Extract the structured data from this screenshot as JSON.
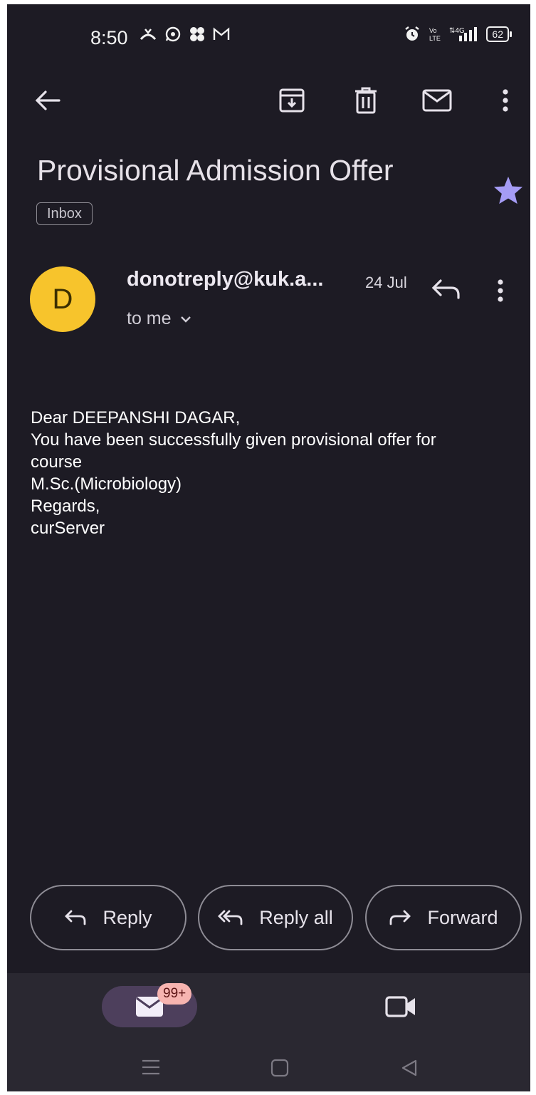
{
  "status_bar": {
    "time": "8:50",
    "left_icons": [
      "missed-call-icon",
      "whatsapp-icon",
      "pinwheel-app-icon",
      "gmail-icon"
    ],
    "right_icons": [
      "alarm-icon",
      "volte-icon",
      "4g-signal-icon"
    ],
    "battery": "62"
  },
  "toolbar": {
    "icons": [
      "back-arrow-icon",
      "archive-icon",
      "delete-icon",
      "mark-unread-icon",
      "more-vert-icon"
    ]
  },
  "email": {
    "subject": "Provisional Admission Offer",
    "label": "Inbox",
    "starred": true,
    "sender_initial": "D",
    "sender": "donotreply@kuk.a...",
    "date": "24 Jul",
    "recipient": "to me",
    "body_lines": [
      "Dear DEEPANSHI DAGAR,",
      "You have been successfully given provisional offer for",
      "course",
      "M.Sc.(Microbiology)",
      "Regards,",
      "curServer"
    ]
  },
  "actions": {
    "reply": "Reply",
    "reply_all": "Reply all",
    "forward": "Forward"
  },
  "bottom_nav": {
    "mail_badge": "99+"
  },
  "colors": {
    "background": "#1d1b24",
    "avatar": "#f7c42c",
    "star": "#a59cf5",
    "badge": "#f7b4b0",
    "nav_bar": "#2a2831"
  }
}
